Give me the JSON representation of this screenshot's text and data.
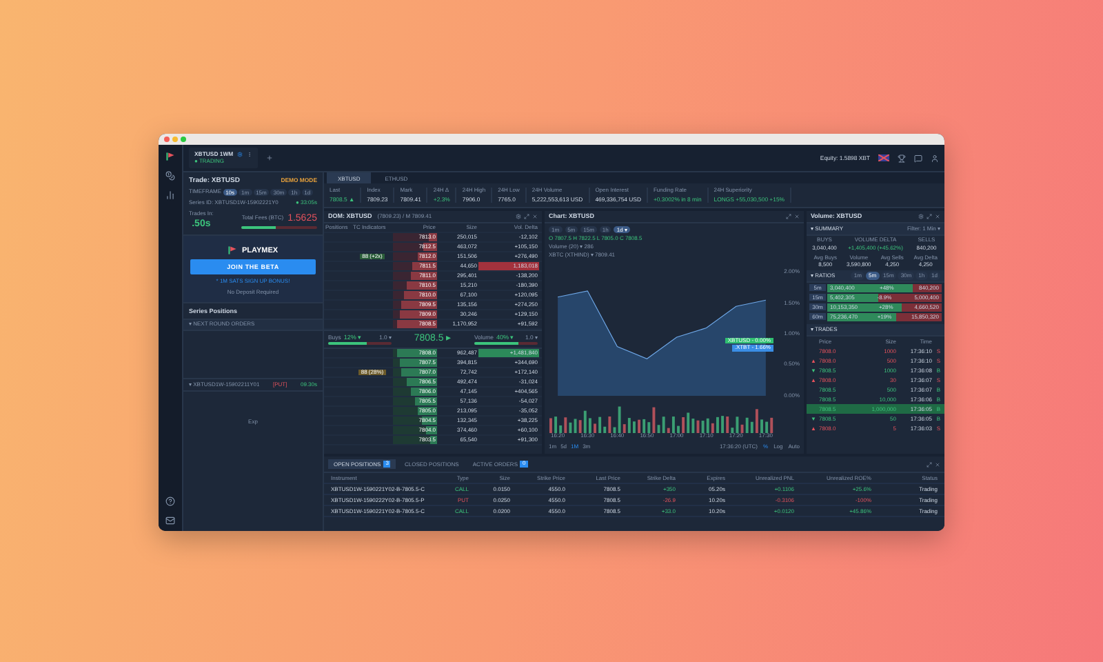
{
  "tab": {
    "title": "XBTUSD 1WM",
    "status": "● TRADING"
  },
  "account": {
    "equity": "Equity: 1.5898 XBT"
  },
  "trade": {
    "title": "Trade: XBTUSD",
    "mode": "DEMO MODE",
    "timeframe_label": "TIMEFRAME",
    "timeframes": [
      {
        "label": "10s",
        "selected": true
      },
      {
        "label": "1m",
        "selected": false
      },
      {
        "label": "15m",
        "selected": false
      },
      {
        "label": "30m",
        "selected": false
      },
      {
        "label": "1h",
        "selected": false
      },
      {
        "label": "1d",
        "selected": false
      }
    ],
    "series_id": "Series ID: XBTUSD1W-15902221Y0",
    "countdown": "● 33:05s",
    "trades_in_label": "Trades In:",
    "trades_in": ".50s",
    "fees_label": "Total Fees (BTC)",
    "fees": "1.5625",
    "balance": {
      "level": 0.45
    }
  },
  "promo": {
    "brand": "PLAYMEX",
    "button": "JOIN THE BETA",
    "bonus": "* 1M SATS SIGN UP BONUS!",
    "note": "No Deposit Required"
  },
  "series_positions": {
    "title": "Series Positions",
    "next_round": "▾ NEXT ROUND ORDERS",
    "position": {
      "name": "▾ XBTUSD1W-15902211Y01",
      "type": "[PUT]",
      "time": "09.30s"
    },
    "footer": "Exp"
  },
  "instruments": [
    {
      "label": "XBTUSD",
      "selected": true
    },
    {
      "label": "ETHUSD",
      "selected": false
    }
  ],
  "stats": [
    {
      "label": "Last",
      "value": "7808.5 ▲",
      "kind": "positive"
    },
    {
      "label": "Index",
      "value": "7809.23",
      "kind": "neutral"
    },
    {
      "label": "Mark",
      "value": "7809.41",
      "kind": "neutral"
    },
    {
      "label": "24H Δ",
      "value": "+2.3%",
      "kind": "positive"
    },
    {
      "label": "24H High",
      "value": "7906.0",
      "kind": "neutral"
    },
    {
      "label": "24H Low",
      "value": "7765.0",
      "kind": "neutral"
    },
    {
      "label": "24H Volume",
      "value": "5,222,553,613 USD",
      "kind": "neutral"
    },
    {
      "label": "Open Interest",
      "value": "469,336,754 USD",
      "kind": "neutral"
    },
    {
      "label": "Funding Rate",
      "value": "+0.3002% in 8 min",
      "kind": "positive"
    },
    {
      "label": "24H Superiority",
      "value": "LONGS +55,030,500 +15%",
      "kind": "positive"
    }
  ],
  "dom": {
    "title": "DOM: XBTUSD",
    "reference": "(7809.23) / M 7809.41",
    "columns": [
      "Positions",
      "TC Indicators",
      "Price",
      "Size",
      "Vol. Delta"
    ],
    "asks": [
      {
        "price": "7813.0",
        "size": "250,015",
        "delta": "-12,102",
        "level": 0.2,
        "highlight": false
      },
      {
        "price": "7812.5",
        "size": "463,072",
        "delta": "+105,150",
        "level": 0.3,
        "highlight": false
      },
      {
        "price": "7812.0",
        "size": "151,506",
        "delta": "+276,490",
        "level": 0.45,
        "highlight": false,
        "tag": "88 (+2x)"
      },
      {
        "price": "7811.5",
        "size": "44,650",
        "delta": "1,183,018",
        "level": 0.55,
        "highlight": true
      },
      {
        "price": "7811.0",
        "size": "295,401",
        "delta": "-138,200",
        "level": 0.6,
        "highlight": false
      },
      {
        "price": "7810.5",
        "size": "15,210",
        "delta": "-180,390",
        "level": 0.7,
        "highlight": false
      },
      {
        "price": "7810.0",
        "size": "67,100",
        "delta": "+120,095",
        "level": 0.75,
        "highlight": false
      },
      {
        "price": "7809.5",
        "size": "135,156",
        "delta": "+274,250",
        "level": 0.8,
        "highlight": false
      },
      {
        "price": "7809.0",
        "size": "30,246",
        "delta": "+129,150",
        "level": 0.85,
        "highlight": false
      },
      {
        "price": "7808.5",
        "size": "1,170,952",
        "delta": "+91,592",
        "level": 0.9,
        "highlight": false
      }
    ],
    "buys": {
      "label": "Buys",
      "value": "12% ▾",
      "lot": "1.0 ▾",
      "level": 0.6
    },
    "mid_price": "7808.5 ▸",
    "volume": {
      "label": "Volume",
      "value": "40% ▾",
      "lot": "1.0 ▾",
      "level": 0.7
    },
    "bids": [
      {
        "price": "7808.0",
        "size": "962,487",
        "delta": "+1,481,840",
        "level": 0.9,
        "highlight": true
      },
      {
        "price": "7807.5",
        "size": "394,815",
        "delta": "+344,690",
        "level": 0.85,
        "highlight": false
      },
      {
        "price": "7807.0",
        "size": "72,742",
        "delta": "+172,140",
        "level": 0.8,
        "highlight": false,
        "tag": "88 (28%)"
      },
      {
        "price": "7806.5",
        "size": "492,474",
        "delta": "-31,024",
        "level": 0.7,
        "highlight": false
      },
      {
        "price": "7806.0",
        "size": "47,145",
        "delta": "+404,565",
        "level": 0.6,
        "highlight": false
      },
      {
        "price": "7805.5",
        "size": "57,136",
        "delta": "-54,027",
        "level": 0.5,
        "highlight": false
      },
      {
        "price": "7805.0",
        "size": "213,095",
        "delta": "-35,052",
        "level": 0.45,
        "highlight": false
      },
      {
        "price": "7804.5",
        "size": "132,345",
        "delta": "+38,225",
        "level": 0.35,
        "highlight": false
      },
      {
        "price": "7804.0",
        "size": "374,460",
        "delta": "+60,100",
        "level": 0.25,
        "highlight": false
      },
      {
        "price": "7803.5",
        "size": "65,540",
        "delta": "+91,300",
        "level": 0.15,
        "highlight": false
      }
    ]
  },
  "chart": {
    "title": "Chart: XBTUSD",
    "intervals": [
      {
        "label": "1m",
        "selected": false
      },
      {
        "label": "5m",
        "selected": false
      },
      {
        "label": "15m",
        "selected": false
      },
      {
        "label": "1h",
        "selected": false
      },
      {
        "label": "1d ▾",
        "selected": true
      }
    ],
    "legend": [
      "O 7807.5  H 7822.5  L 7805.0  C 7808.5",
      "Volume (20) ▾ 286",
      "XBTC (XTHIND) ▾ 7809.41"
    ],
    "tags": [
      {
        "label": "XBTUSD - 0.00%",
        "color": "#2fbf71"
      },
      {
        "label": ".XTBT - 1.66%",
        "color": "#3a8ee6"
      }
    ],
    "chart_data": {
      "type": "area",
      "categories": [
        "16:20",
        "16:30",
        "16:40",
        "16:50",
        "17:00",
        "17:10",
        "17:20",
        "17:30"
      ],
      "series": [
        {
          "color": "#6fa8e8",
          "values": [
            1.6,
            1.7,
            0.8,
            0.6,
            0.95,
            1.1,
            1.45,
            1.55
          ]
        }
      ],
      "ylim": [
        0,
        2
      ],
      "yticks": [
        {
          "value": 0,
          "label": "0.00%"
        },
        {
          "value": 0.5,
          "label": "0.50%"
        },
        {
          "value": 1,
          "label": "1.00%"
        },
        {
          "value": 1.5,
          "label": "1.50%"
        },
        {
          "value": 2,
          "label": "2.00%"
        }
      ]
    },
    "ranges": [
      {
        "label": "1m",
        "selected": false
      },
      {
        "label": "5d",
        "selected": false
      },
      {
        "label": "1M",
        "selected": true
      },
      {
        "label": "3m",
        "selected": false
      }
    ],
    "time": "17:36:20 (UTC)",
    "options": [
      "%",
      "Log",
      "Auto"
    ]
  },
  "volume_panel": {
    "title": "Volume: XBTUSD",
    "summary": "▾ SUMMARY",
    "filter": "Filter: 1 Min ▾",
    "summary_cells": [
      {
        "label": "BUYS",
        "value": "3,040,400",
        "kind": "neutral"
      },
      {
        "label": "VOLUME DELTA",
        "value": "+1,405,400 (+45.62%)",
        "kind": "positive"
      },
      {
        "label": "SELLS",
        "value": "840,200",
        "kind": "neutral"
      }
    ],
    "averages": [
      {
        "label": "Avg Buys",
        "value": "8,500"
      },
      {
        "label": "Volume",
        "value": "3,590,800"
      },
      {
        "label": "Avg Sells",
        "value": "4,250"
      },
      {
        "label": "Avg Delta",
        "value": "4,250"
      }
    ],
    "ratios_label": "▾ RATIOS",
    "ratio_periods": [
      {
        "label": "1m",
        "selected": false
      },
      {
        "label": "5m",
        "selected": true
      },
      {
        "label": "15m",
        "selected": false
      },
      {
        "label": "30m",
        "selected": false
      },
      {
        "label": "1h",
        "selected": false
      },
      {
        "label": "1d",
        "selected": false
      }
    ],
    "ratios": [
      {
        "period": "5m",
        "buys": "3,040,400",
        "share": "+48%",
        "sells": "840,200",
        "level": 0.75
      },
      {
        "period": "15m",
        "buys": "5,402,305",
        "share": "-8.9%",
        "sells": "5,000,400",
        "level": 0.45
      },
      {
        "period": "30m",
        "buys": "10,153,350",
        "share": "+28%",
        "sells": "4,660,520",
        "level": 0.65
      },
      {
        "period": "60m",
        "buys": "75,236,470",
        "share": "+19%",
        "sells": "15,850,320",
        "level": 0.6
      }
    ],
    "trades_label": "▾ TRADES",
    "trade_columns": [
      "Price",
      "Size",
      "Time"
    ],
    "trades": [
      {
        "price": "7808.0",
        "size": "1000",
        "time": "17:36:10",
        "kind": "negative",
        "flag": "S",
        "highlight": false
      },
      {
        "arrow": "▲",
        "price": "7808.0",
        "size": "500",
        "time": "17:36:10",
        "kind": "negative",
        "flag": "S",
        "highlight": false
      },
      {
        "arrow": "▼",
        "price": "7808.5",
        "size": "1000",
        "time": "17:36:08",
        "kind": "positive",
        "flag": "B",
        "highlight": false
      },
      {
        "arrow": "▲",
        "price": "7808.0",
        "size": "30",
        "time": "17:36:07",
        "kind": "negative",
        "flag": "S",
        "highlight": false
      },
      {
        "price": "7808.5",
        "size": "500",
        "time": "17:36:07",
        "kind": "positive",
        "flag": "B",
        "highlight": false
      },
      {
        "price": "7808.5",
        "size": "10,000",
        "time": "17:36:06",
        "kind": "positive",
        "flag": "B",
        "highlight": false
      },
      {
        "price": "7808.5",
        "size": "1,000,000",
        "time": "17:36:05",
        "kind": "positive",
        "flag": "B",
        "highlight": true
      },
      {
        "arrow": "▼",
        "price": "7808.5",
        "size": "50",
        "time": "17:36:05",
        "kind": "positive",
        "flag": "B",
        "highlight": false
      },
      {
        "arrow": "▲",
        "price": "7808.0",
        "size": "5",
        "time": "17:36:03",
        "kind": "negative",
        "flag": "S",
        "highlight": false
      }
    ]
  },
  "orders": {
    "tabs": [
      {
        "label": "OPEN POSITIONS",
        "count": "3",
        "selected": true
      },
      {
        "label": "CLOSED POSITIONS",
        "selected": false
      },
      {
        "label": "ACTIVE ORDERS",
        "count": "0",
        "selected": false
      }
    ],
    "columns": [
      "Instrument",
      "Type",
      "Size",
      "Strike Price",
      "Last Price",
      "Strike Delta",
      "Expires",
      "Unrealized PNL",
      "Unrealized ROE%",
      "Status"
    ],
    "rows": [
      {
        "instrument": "XBTUSD1W-1590221Y02-B-7805.5-C",
        "type": "CALL",
        "size": "0.0150",
        "strike": "4550.0",
        "last": "7808.5",
        "delta": "+350",
        "expires": "05.20s",
        "pnl": "+0.1106",
        "roe": "+25.6%",
        "status": "Trading",
        "kind": "positive"
      },
      {
        "instrument": "XBTUSD1W-1590222Y02-B-7805.5-P",
        "type": "PUT",
        "size": "0.0250",
        "strike": "4550.0",
        "last": "7808.5",
        "delta": "-26.9",
        "expires": "10.20s",
        "pnl": "-0.3106",
        "roe": "-100%",
        "status": "Trading",
        "kind": "negative"
      },
      {
        "instrument": "XBTUSD1W-1590221Y02-B-7805.5-C",
        "type": "CALL",
        "size": "0.0200",
        "strike": "4550.0",
        "last": "7808.5",
        "delta": "+33.0",
        "expires": "10.20s",
        "pnl": "+0.0120",
        "roe": "+45.86%",
        "status": "Trading",
        "kind": "positive"
      }
    ]
  }
}
